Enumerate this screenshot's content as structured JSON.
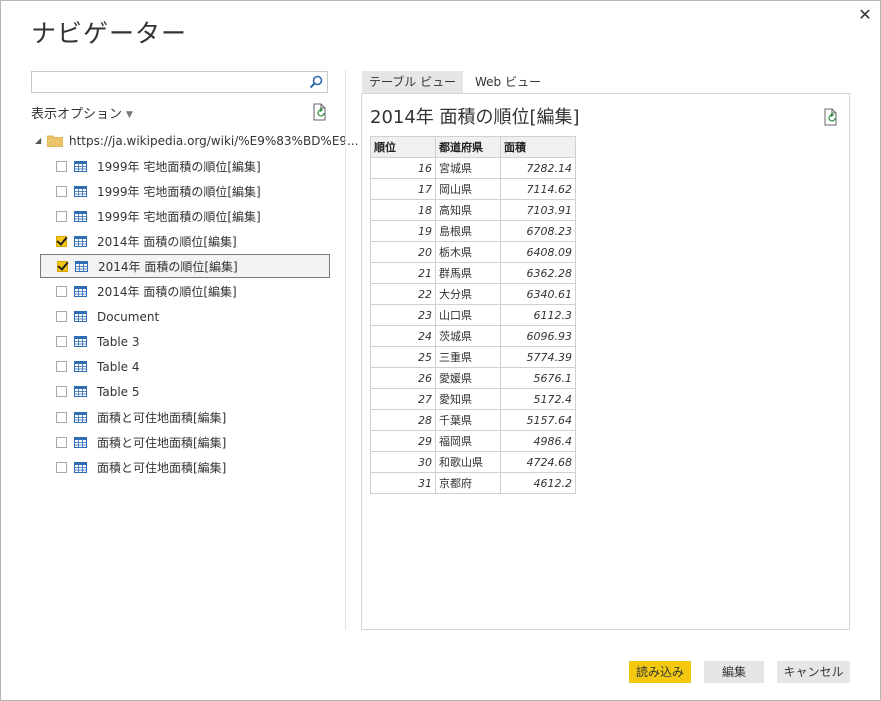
{
  "window": {
    "title": "ナビゲーター",
    "close": "✕"
  },
  "left": {
    "search": {
      "value": "",
      "placeholder": ""
    },
    "options_label": "表示オプション",
    "root_label": "https://ja.wikipedia.org/wiki/%E9%83%BD%E9...",
    "items": [
      {
        "label": "1999年 宅地面積の順位[編集]",
        "checked": false,
        "selected": false
      },
      {
        "label": "1999年 宅地面積の順位[編集]",
        "checked": false,
        "selected": false
      },
      {
        "label": "1999年 宅地面積の順位[編集]",
        "checked": false,
        "selected": false
      },
      {
        "label": "2014年 面積の順位[編集]",
        "checked": true,
        "selected": false
      },
      {
        "label": "2014年 面積の順位[編集]",
        "checked": true,
        "selected": true
      },
      {
        "label": "2014年 面積の順位[編集]",
        "checked": false,
        "selected": false
      },
      {
        "label": "Document",
        "checked": false,
        "selected": false
      },
      {
        "label": "Table 3",
        "checked": false,
        "selected": false
      },
      {
        "label": "Table 4",
        "checked": false,
        "selected": false
      },
      {
        "label": "Table 5",
        "checked": false,
        "selected": false
      },
      {
        "label": "面積と可住地面積[編集]",
        "checked": false,
        "selected": false
      },
      {
        "label": "面積と可住地面積[編集]",
        "checked": false,
        "selected": false
      },
      {
        "label": "面積と可住地面積[編集]",
        "checked": false,
        "selected": false
      }
    ]
  },
  "right": {
    "tabs": [
      {
        "label": "テーブル ビュー",
        "active": true
      },
      {
        "label": "Web ビュー",
        "active": false
      }
    ],
    "preview_title": "2014年 面積の順位[編集]",
    "table": {
      "headers": [
        "順位",
        "都道府県",
        "面積"
      ],
      "rows": [
        [
          "16",
          "宮城県",
          "7282.14"
        ],
        [
          "17",
          "岡山県",
          "7114.62"
        ],
        [
          "18",
          "高知県",
          "7103.91"
        ],
        [
          "19",
          "島根県",
          "6708.23"
        ],
        [
          "20",
          "栃木県",
          "6408.09"
        ],
        [
          "21",
          "群馬県",
          "6362.28"
        ],
        [
          "22",
          "大分県",
          "6340.61"
        ],
        [
          "23",
          "山口県",
          "6112.3"
        ],
        [
          "24",
          "茨城県",
          "6096.93"
        ],
        [
          "25",
          "三重県",
          "5774.39"
        ],
        [
          "26",
          "愛媛県",
          "5676.1"
        ],
        [
          "27",
          "愛知県",
          "5172.4"
        ],
        [
          "28",
          "千葉県",
          "5157.64"
        ],
        [
          "29",
          "福岡県",
          "4986.4"
        ],
        [
          "30",
          "和歌山県",
          "4724.68"
        ],
        [
          "31",
          "京都府",
          "4612.2"
        ]
      ]
    }
  },
  "buttons": {
    "load": "読み込み",
    "edit": "編集",
    "cancel": "キャンセル"
  },
  "colors": {
    "accent": "#f2c811",
    "selected_border": "#7a7a7a",
    "header_bg": "#f0f0f0"
  }
}
